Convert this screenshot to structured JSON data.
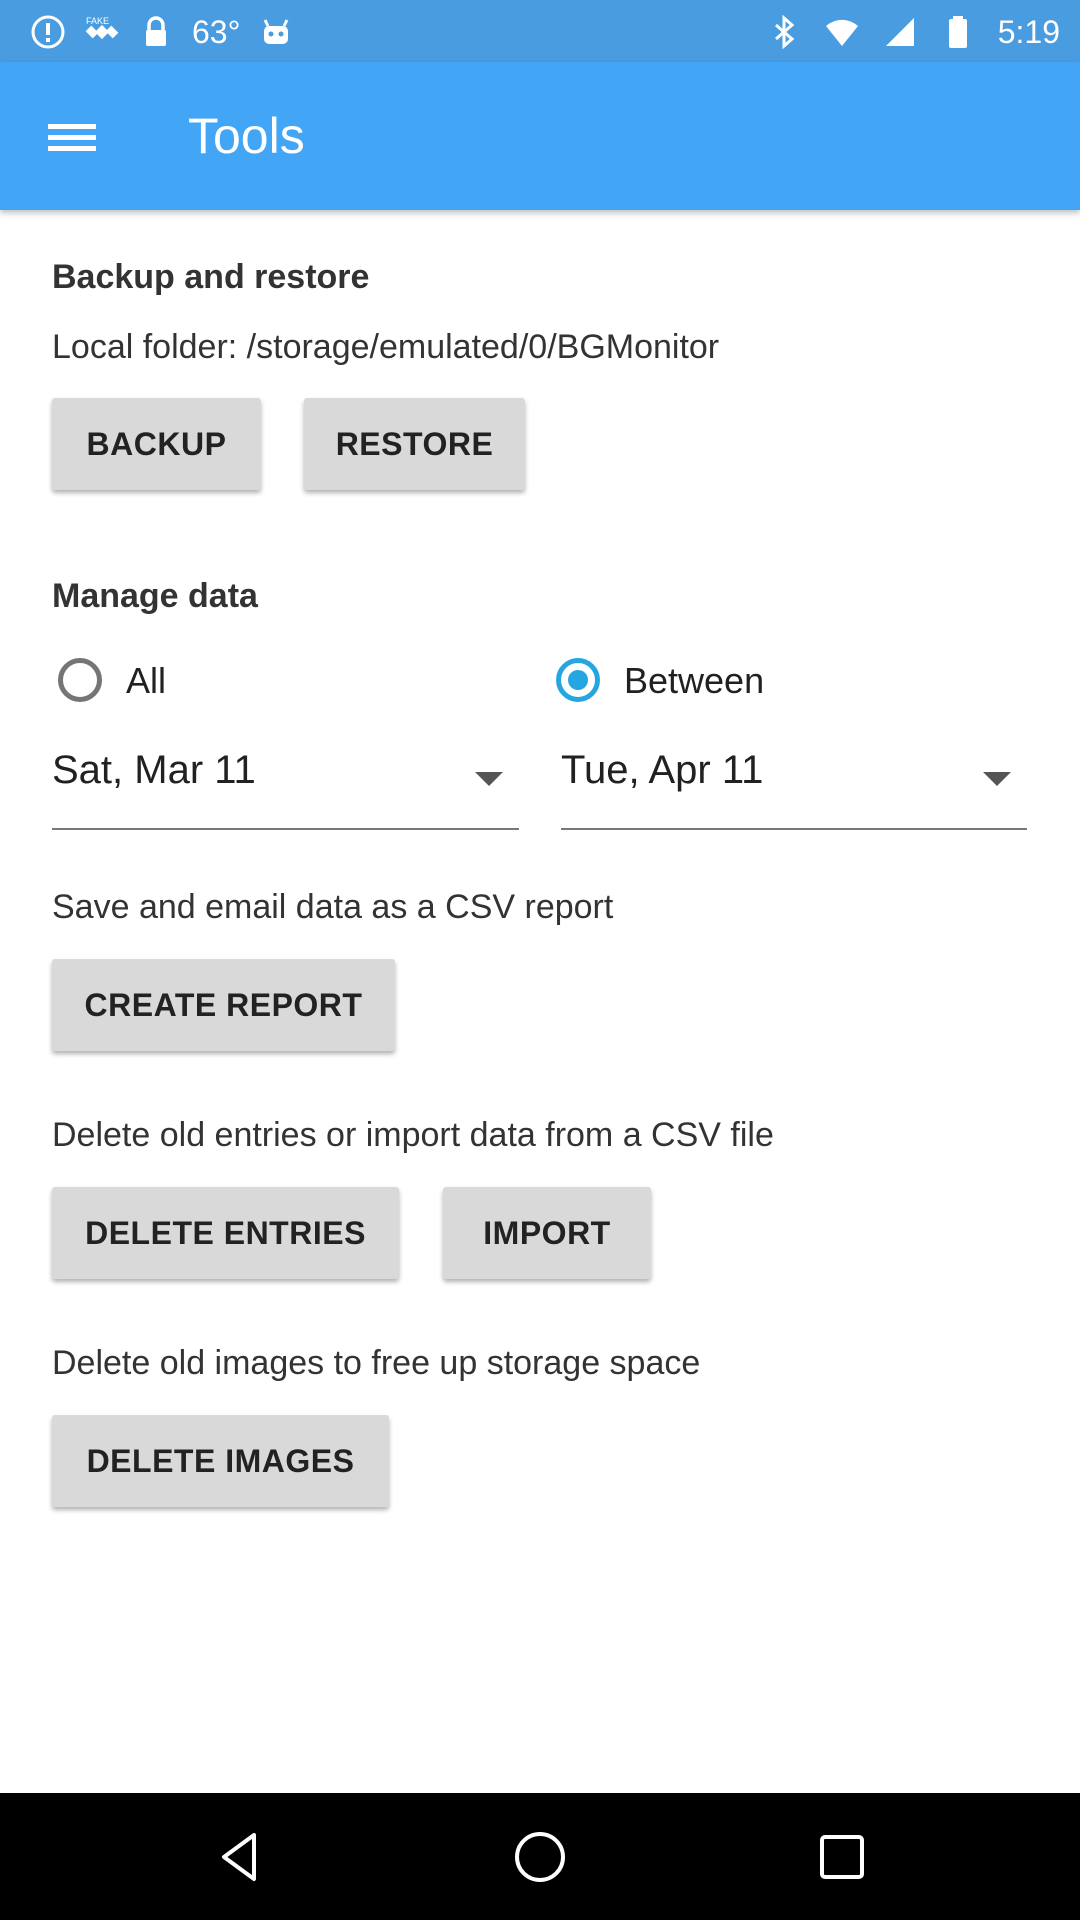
{
  "status_bar": {
    "temperature": "63°",
    "time": "5:19",
    "left_icons": [
      "info-icon",
      "fake-gps-icon",
      "lock-icon",
      "android-icon"
    ],
    "right_icons": [
      "bluetooth-icon",
      "wifi-icon",
      "signal-icon",
      "battery-icon"
    ]
  },
  "app_bar": {
    "title": "Tools",
    "menu_icon": "hamburger-menu-icon",
    "color": "#42a5f5"
  },
  "backup_restore": {
    "title": "Backup and restore",
    "folder_text": "Local folder: /storage/emulated/0/BGMonitor",
    "backup_label": "BACKUP",
    "restore_label": "RESTORE"
  },
  "manage_data": {
    "title": "Manage data",
    "radio_all_label": "All",
    "radio_between_label": "Between",
    "selected": "Between",
    "start_date": "Sat, Mar 11",
    "end_date": "Tue, Apr 11",
    "accent_color": "#26a6e0"
  },
  "report": {
    "description": "Save and email data as a CSV report",
    "create_label": "CREATE REPORT"
  },
  "entries": {
    "description": "Delete old entries or import data from a CSV file",
    "delete_label": "DELETE ENTRIES",
    "import_label": "IMPORT"
  },
  "images": {
    "description": "Delete old images to free up storage space",
    "delete_label": "DELETE IMAGES"
  },
  "nav_bar": {
    "buttons": [
      "back-icon",
      "home-icon",
      "recents-icon"
    ]
  }
}
